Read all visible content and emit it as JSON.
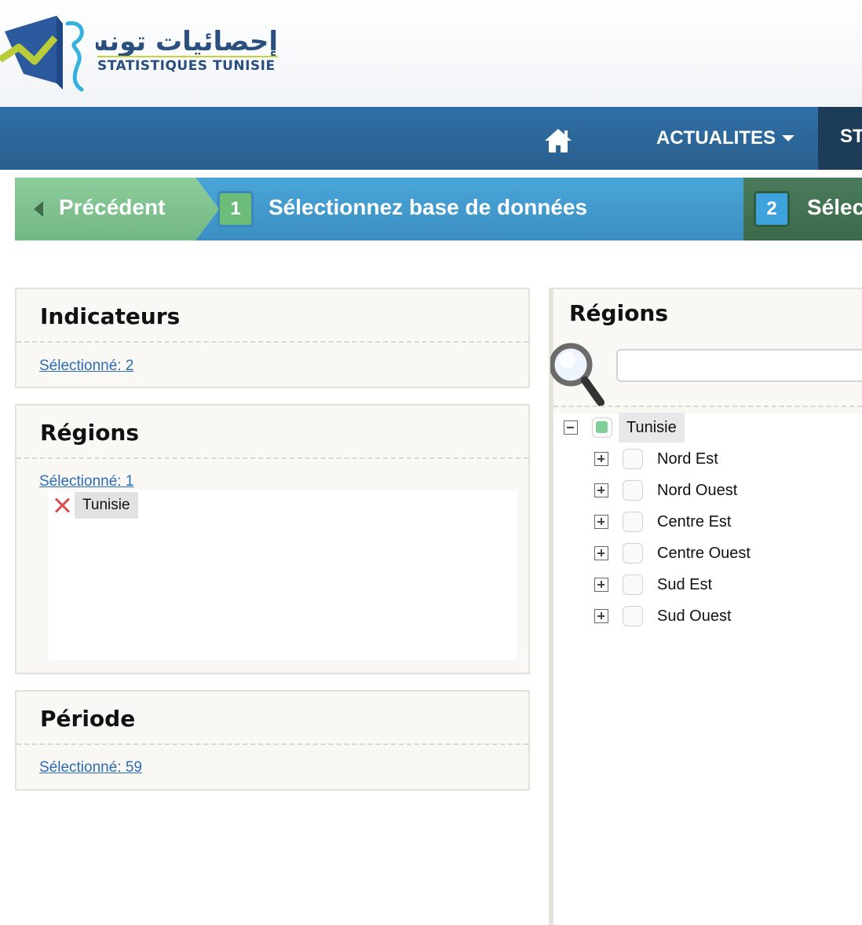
{
  "header": {
    "logo_arabic": "إحصائيات تونس",
    "logo_latin": "STATISTIQUES TUNISIE"
  },
  "nav": {
    "home_icon": "home-icon",
    "actualites": "ACTUALITES",
    "next_item_partial": "ST"
  },
  "wizard": {
    "previous": "Précédent",
    "step1_number": "1",
    "step1_label": "Sélectionnez base de données",
    "step2_number": "2",
    "step2_label": "Sélec"
  },
  "left": {
    "indicateurs": {
      "title": "Indicateurs",
      "selected": "Sélectionné: 2"
    },
    "regions": {
      "title": "Régions",
      "selected": "Sélectionné: 1",
      "items": [
        "Tunisie"
      ]
    },
    "periode": {
      "title": "Période",
      "selected": "Sélectionné: 59"
    }
  },
  "right": {
    "title": "Régions",
    "search_value": "",
    "tree": {
      "root": {
        "label": "Tunisie",
        "expanded": true,
        "checked": true
      },
      "children": [
        {
          "label": "Nord Est",
          "checked": false
        },
        {
          "label": "Nord Ouest",
          "checked": false
        },
        {
          "label": "Centre Est",
          "checked": false
        },
        {
          "label": "Centre Ouest",
          "checked": false
        },
        {
          "label": "Sud Est",
          "checked": false
        },
        {
          "label": "Sud Ouest",
          "checked": false
        }
      ]
    }
  },
  "colors": {
    "nav_blue": "#2f6fa5",
    "step_blue": "#3a8ec2",
    "prev_green": "#73b884",
    "link_blue": "#2b6cb5",
    "remove_red": "#e04b4b"
  }
}
